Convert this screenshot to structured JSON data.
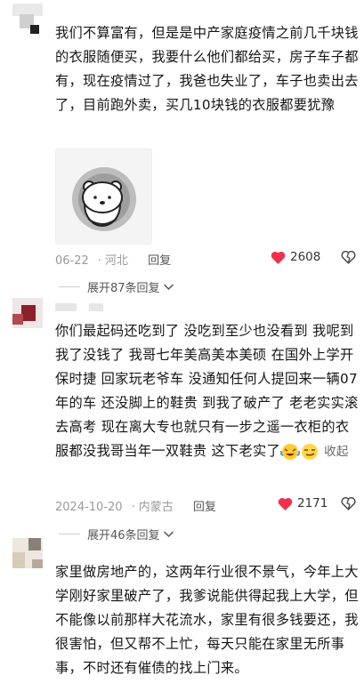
{
  "comments": [
    {
      "text": "我们不算富有，但是是中产家庭疫情之前几千块钱的衣服随便买，我要什么他们都给买，房子车子都有，现在疫情过了，我爸也失业了，车子也卖出去了，目前跑外卖，买几10块钱的衣服都要犹豫",
      "date": "06-22",
      "location": "河北",
      "reply_label": "回复",
      "likes": "2608",
      "expand_label": "展开87条回复"
    },
    {
      "text": "你们最起码还吃到了 没吃到至少也没看到 我呢到我了没钱了 我哥七年美高美本美硕 在国外上学开保时捷 回家玩老爷车 没通知任何人提回来一辆07年的车 还没脚上的鞋贵 到我了破产了 老老实实滚去高考 现在离大专也就只有一步之遥一衣柜的衣服都没我哥当年一双鞋贵 这下老实了",
      "collapse_label": "收起",
      "date": "2024-10-20",
      "location": "内蒙古",
      "reply_label": "回复",
      "likes": "2171",
      "expand_label": "展开46条回复"
    },
    {
      "text": "家里做房地产的，这两年行业很不景气，今年上大学刚好家里破产了，我爹说能供得起我上大学，但不能像以前那样大花流水，家里有很多钱要还，我很害怕，但又帮不上忙，每天只能在家里无所事事，不时还有催债的找上门来。"
    }
  ],
  "colors": {
    "accent_heart": "#f1304d",
    "meta_gray": "#9a9a9a"
  },
  "icons": [
    "heart-icon",
    "dislike-icon",
    "chevron-down-icon",
    "sticker-bear",
    "laughing-crying-emoji",
    "smirk-emoji"
  ]
}
